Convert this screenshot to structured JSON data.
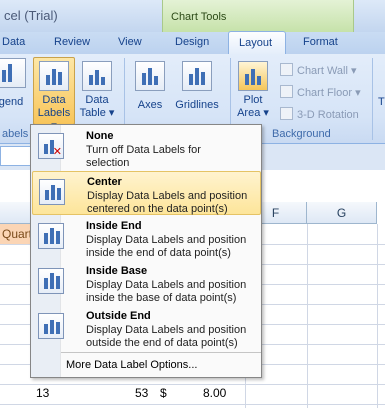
{
  "window": {
    "title": "cel (Trial)",
    "tools_label": "Chart Tools"
  },
  "tabs": [
    "Data",
    "Review",
    "View",
    "Design",
    "Layout",
    "Format"
  ],
  "ribbon": {
    "legend_label": "gend",
    "data_labels": {
      "line1": "Data",
      "line2": "Labels ▾"
    },
    "data_table": {
      "line1": "Data",
      "line2": "Table ▾"
    },
    "axes_label": "Axes",
    "gridlines_label": "Gridlines",
    "plot_area": {
      "line1": "Plot",
      "line2": "Area ▾"
    },
    "chart_wall": "Chart Wall ▾",
    "chart_floor": "Chart Floor ▾",
    "rotation": "3-D Rotation",
    "group_labels": [
      "abels",
      "Background"
    ],
    "right_partial": "T"
  },
  "grid": {
    "columns": [
      "F",
      "G"
    ],
    "orange_cell": "Quarte",
    "row_values": {
      "a": "13",
      "b": "53",
      "c": "$",
      "d": "8.00"
    }
  },
  "menu": {
    "items": [
      {
        "title": "None",
        "desc1": "Turn off Data Labels for",
        "desc2": "selection"
      },
      {
        "title": "Center",
        "desc1": "Display Data Labels and position",
        "desc2": "centered on the data point(s)"
      },
      {
        "title": "Inside End",
        "desc1": "Display Data Labels and position",
        "desc2": "inside the end of data point(s)"
      },
      {
        "title": "Inside Base",
        "desc1": "Display Data Labels and position",
        "desc2": "inside the base of data point(s)"
      },
      {
        "title": "Outside End",
        "desc1": "Display Data Labels and position",
        "desc2": "outside the end of data point(s)"
      }
    ],
    "more": "More Data Label Options..."
  }
}
